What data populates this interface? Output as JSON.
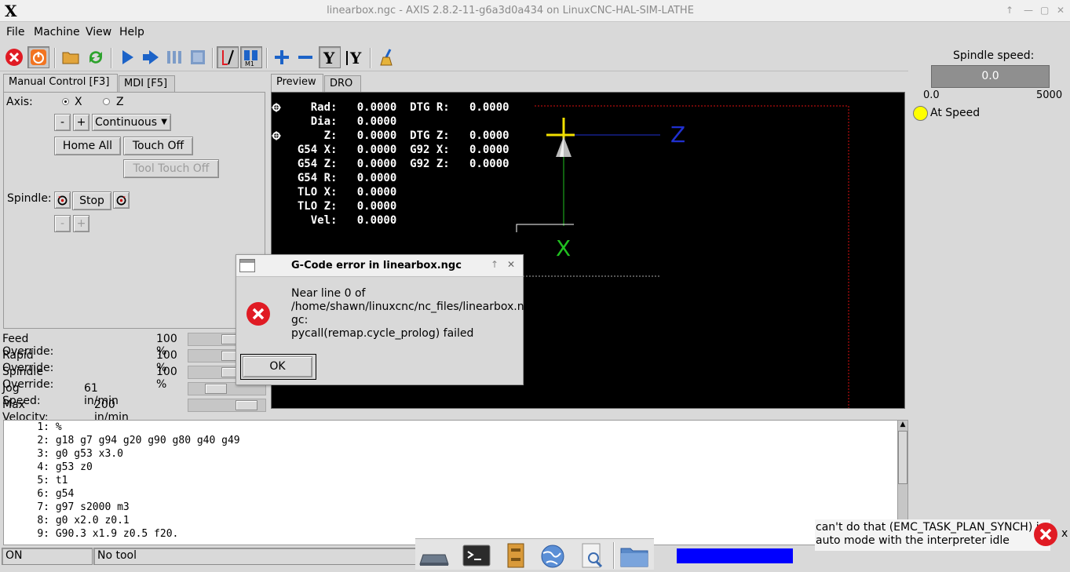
{
  "window": {
    "title": "linearbox.ngc - AXIS 2.8.2-11-g6a3d0a434 on LinuxCNC-HAL-SIM-LATHE",
    "logo": "X"
  },
  "menu": [
    "File",
    "Machine",
    "View",
    "Help"
  ],
  "tabs_left": [
    "Manual Control [F3]",
    "MDI [F5]"
  ],
  "tabs_right": [
    "Preview",
    "DRO"
  ],
  "manual": {
    "axis_label": "Axis:",
    "axis_x": "X",
    "axis_z": "Z",
    "minus": "-",
    "plus": "+",
    "jog_mode": "Continuous",
    "home_all": "Home All",
    "touch_off": "Touch Off",
    "tool_touch_off": "Tool Touch Off",
    "spindle_label": "Spindle:",
    "stop": "Stop"
  },
  "overrides": [
    {
      "label": "Feed Override:",
      "value": "100 %",
      "fraction": 0.6
    },
    {
      "label": "Rapid Override:",
      "value": "100 %",
      "fraction": 0.6
    },
    {
      "label": "Spindle Override:",
      "value": "100 %",
      "fraction": 0.6
    },
    {
      "label": "Jog Speed:",
      "value": "61 in/min",
      "fraction": 0.3
    },
    {
      "label": "Max Velocity:",
      "value": "200 in/min",
      "fraction": 0.85
    }
  ],
  "dro": [
    "    Rad:   0.0000  DTG R:   0.0000",
    "    Dia:   0.0000",
    "      Z:   0.0000  DTG Z:   0.0000",
    "  G54 X:   0.0000  G92 X:   0.0000",
    "  G54 Z:   0.0000  G92 Z:   0.0000",
    "  G54 R:   0.0000",
    "  TLO X:   0.0000",
    "  TLO Z:   0.0000",
    "    Vel:   0.0000"
  ],
  "preview_axes": {
    "z": "Z",
    "x": "X"
  },
  "spindle": {
    "label": "Spindle speed:",
    "value": "0.0",
    "min": "0.0",
    "max": "5000",
    "at_speed": "At Speed"
  },
  "code": [
    {
      "n": "1:",
      "t": "%"
    },
    {
      "n": "2:",
      "t": "g18 g7 g94 g20 g90 g80 g40 g49"
    },
    {
      "n": "3:",
      "t": "g0 g53 x3.0"
    },
    {
      "n": "4:",
      "t": "g53 z0"
    },
    {
      "n": "5:",
      "t": "t1"
    },
    {
      "n": "6:",
      "t": "g54"
    },
    {
      "n": "7:",
      "t": "g97 s2000 m3"
    },
    {
      "n": "8:",
      "t": "g0 x2.0 z0.1"
    },
    {
      "n": "9:",
      "t": "G90.3 x1.9 z0.5 f20."
    }
  ],
  "status": {
    "state": "ON",
    "tool": "No tool"
  },
  "dialog": {
    "title": "G-Code error in linearbox.ngc",
    "line1": "Near line 0 of",
    "line2": "/home/shawn/linuxcnc/nc_files/linearbox.n",
    "line3": "gc:",
    "line4": "pycall(remap.cycle_prolog) failed",
    "ok": "OK"
  },
  "notification": {
    "line1": "can't do that (EMC_TASK_PLAN_SYNCH) in",
    "line2": "auto mode with the interpreter idle",
    "close": "x"
  },
  "colors": {
    "error_red": "#e01b24",
    "jog_blue": "#1c63c8",
    "progress_blue": "#0000ff",
    "at_speed_yellow": "#ffff00"
  }
}
